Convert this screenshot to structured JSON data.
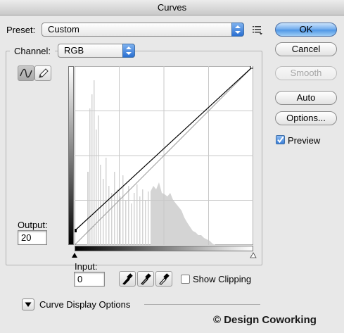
{
  "window": {
    "title": "Curves"
  },
  "preset": {
    "label": "Preset:",
    "value": "Custom"
  },
  "channel": {
    "label": "Channel:",
    "value": "RGB"
  },
  "buttons": {
    "ok": "OK",
    "cancel": "Cancel",
    "smooth": "Smooth",
    "auto": "Auto",
    "options": "Options..."
  },
  "preview": {
    "label": "Preview",
    "checked": true
  },
  "output": {
    "label": "Output:",
    "value": "20"
  },
  "input": {
    "label": "Input:",
    "value": "0"
  },
  "show_clipping": {
    "label": "Show Clipping",
    "checked": false
  },
  "curve_display_options": {
    "label": "Curve Display Options"
  },
  "watermark": "© Design Coworking",
  "icons": [
    "presets-menu-icon",
    "curve-point-tool-icon",
    "pencil-tool-icon",
    "black-point-eyedropper-icon",
    "gray-point-eyedropper-icon",
    "white-point-eyedropper-icon",
    "disclosure-triangle-icon"
  ],
  "colors": {
    "default_button": "#5a9fe8",
    "histogram": "#d4d4d4",
    "grid": "#c8c8c8"
  }
}
